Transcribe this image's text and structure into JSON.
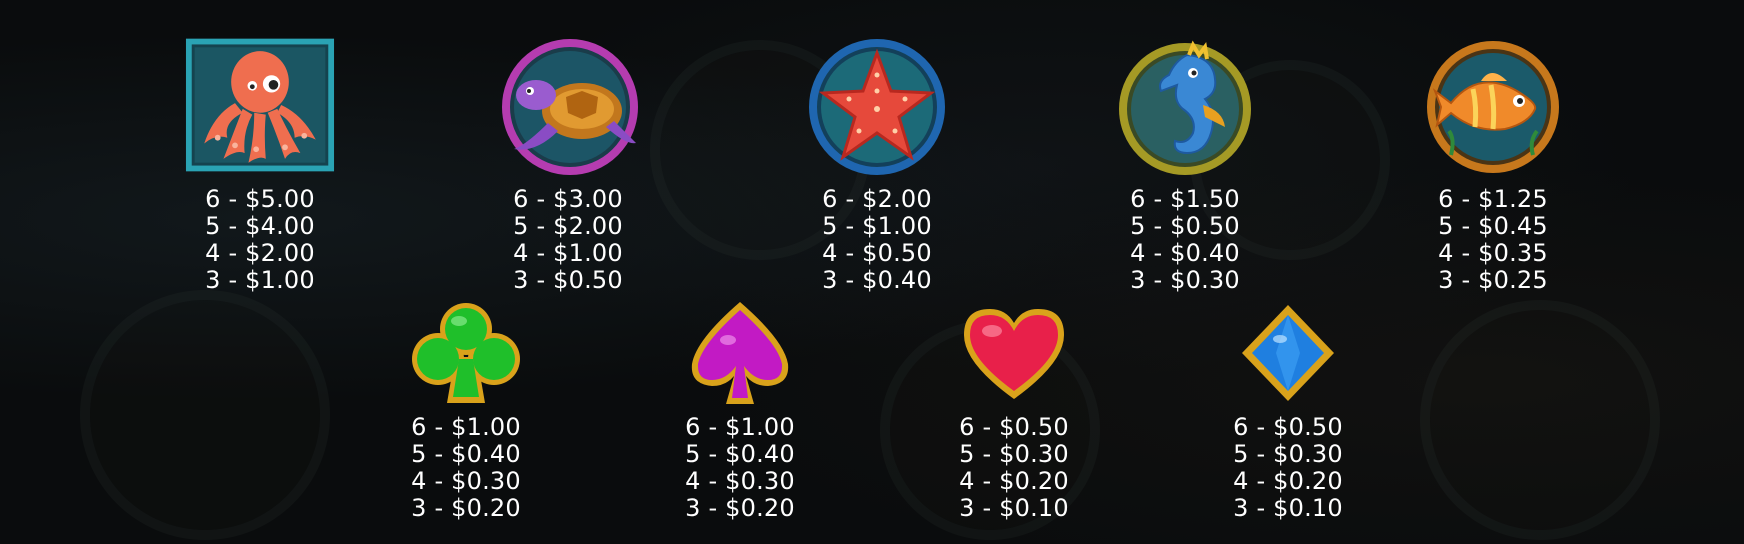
{
  "paytable": {
    "premium": [
      {
        "icon": "octopus-icon",
        "pays": [
          "6 - $5.00",
          "5 - $4.00",
          "4 - $2.00",
          "3 - $1.00"
        ]
      },
      {
        "icon": "turtle-icon",
        "pays": [
          "6 - $3.00",
          "5 - $2.00",
          "4 - $1.00",
          "3 - $0.50"
        ]
      },
      {
        "icon": "starfish-icon",
        "pays": [
          "6 - $2.00",
          "5 - $1.00",
          "4 - $0.50",
          "3 - $0.40"
        ]
      },
      {
        "icon": "seahorse-icon",
        "pays": [
          "6 - $1.50",
          "5 - $0.50",
          "4 - $0.40",
          "3 - $0.30"
        ]
      },
      {
        "icon": "fish-icon",
        "pays": [
          "6 - $1.25",
          "5 - $0.45",
          "4 - $0.35",
          "3 - $0.25"
        ]
      }
    ],
    "low": [
      {
        "icon": "club-icon",
        "color": "#1fbf2a",
        "pays": [
          "6 - $1.00",
          "5 - $0.40",
          "4 - $0.30",
          "3 - $0.20"
        ]
      },
      {
        "icon": "spade-icon",
        "color": "#c21ac4",
        "pays": [
          "6 - $1.00",
          "5 - $0.40",
          "4 - $0.30",
          "3 - $0.20"
        ]
      },
      {
        "icon": "heart-icon",
        "color": "#e8204a",
        "pays": [
          "6 - $0.50",
          "5 - $0.30",
          "4 - $0.20",
          "3 - $0.10"
        ]
      },
      {
        "icon": "diamond-icon",
        "color": "#1f7fe0",
        "pays": [
          "6 - $0.50",
          "5 - $0.30",
          "4 - $0.20",
          "3 - $0.10"
        ]
      }
    ]
  },
  "colors": {
    "background": "#0a0c0d",
    "text": "#ffffff",
    "gold_frame": "#d9a21b",
    "teal_frame": "#1f8fa0"
  }
}
